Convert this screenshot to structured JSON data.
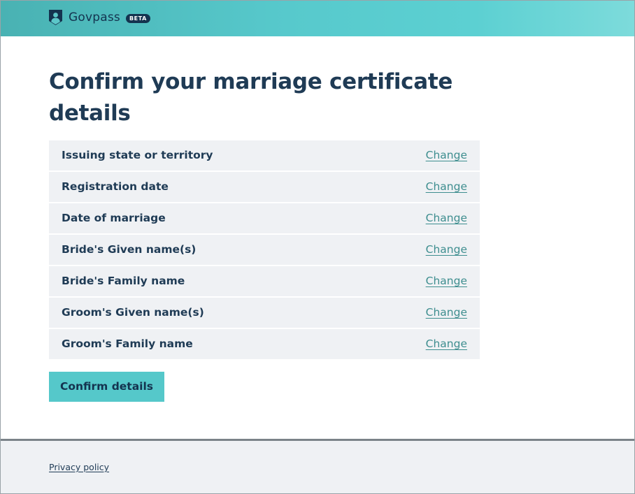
{
  "header": {
    "app_name": "Govpass",
    "badge": "BETA",
    "logo_icon": "shield-person-icon",
    "background_colors": [
      "#49b2b3",
      "#5cd0d2",
      "#7ddbdb"
    ]
  },
  "main": {
    "title": "Confirm your marriage certificate details",
    "rows": [
      {
        "label": "Issuing state or territory",
        "action": "Change"
      },
      {
        "label": "Registration date",
        "action": "Change"
      },
      {
        "label": "Date of marriage",
        "action": "Change"
      },
      {
        "label": "Bride's Given name(s)",
        "action": "Change"
      },
      {
        "label": "Bride's Family name",
        "action": "Change"
      },
      {
        "label": "Groom's Given name(s)",
        "action": "Change"
      },
      {
        "label": "Groom's Family name",
        "action": "Change"
      }
    ],
    "confirm_button": "Confirm details"
  },
  "footer": {
    "privacy_link": "Privacy policy"
  },
  "colors": {
    "heading": "#1f3b55",
    "link": "#3e8e8f",
    "button": "#55c8ca",
    "row_background": "#eff1f4"
  }
}
